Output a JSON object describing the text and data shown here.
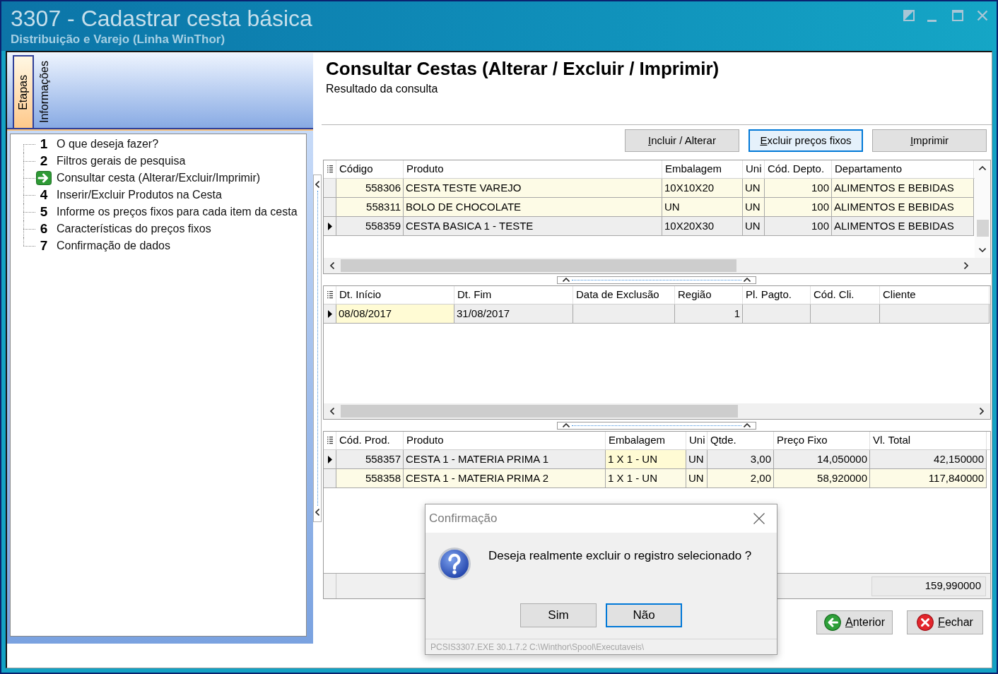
{
  "window": {
    "title": "3307 - Cadastrar cesta básica",
    "subtitle": "Distribuição e Varejo (Linha WinThor)"
  },
  "side_panel": {
    "tabs": [
      {
        "label": "Etapas",
        "selected": true
      },
      {
        "label": "Informações",
        "selected": false
      }
    ],
    "steps": [
      {
        "number": "1",
        "label": "O que deseja fazer?",
        "selected": false
      },
      {
        "number": "2",
        "label": "Filtros gerais de pesquisa",
        "selected": false
      },
      {
        "label": "Consultar cesta (Alterar/Excluir/Imprimir)",
        "selected": true
      },
      {
        "number": "4",
        "label": "Inserir/Excluir Produtos na Cesta",
        "selected": false
      },
      {
        "number": "5",
        "label": "Informe os preços fixos para cada item da cesta",
        "selected": false
      },
      {
        "number": "6",
        "label": "Características do preços fixos",
        "selected": false
      },
      {
        "number": "7",
        "label": "Confirmação de dados",
        "selected": false
      }
    ]
  },
  "page": {
    "title": "Consultar Cestas (Alterar / Excluir / Imprimir)",
    "subtitle": "Resultado da consulta"
  },
  "toolbar": [
    {
      "label": "Incluir / Alterar",
      "focused": false
    },
    {
      "label": "Excluir preços fixos",
      "focused": true
    },
    {
      "label": "Imprimir",
      "focused": false
    }
  ],
  "grids": [
    {
      "columns": [
        {
          "label": "Código",
          "kind": "number"
        },
        {
          "label": "Produto",
          "kind": "text"
        },
        {
          "label": "Embalagem",
          "kind": "text"
        },
        {
          "label": "Uni",
          "kind": "text"
        },
        {
          "label": "Cód. Depto.",
          "kind": "number"
        },
        {
          "label": "Departamento",
          "kind": "text"
        }
      ],
      "rows": [
        {
          "selected": false,
          "cells": [
            {
              "text": "558306",
              "focused": false
            },
            {
              "text": "CESTA TESTE VAREJO",
              "focused": false
            },
            {
              "text": "10X10X20",
              "focused": false
            },
            {
              "text": "UN",
              "focused": false
            },
            {
              "text": "100",
              "focused": false
            },
            {
              "text": "ALIMENTOS E BEBIDAS",
              "focused": false
            }
          ]
        },
        {
          "selected": false,
          "cells": [
            {
              "text": "558311",
              "focused": false
            },
            {
              "text": "BOLO DE CHOCOLATE",
              "focused": false
            },
            {
              "text": "UN",
              "focused": false
            },
            {
              "text": "UN",
              "focused": false
            },
            {
              "text": "100",
              "focused": false
            },
            {
              "text": "ALIMENTOS E BEBIDAS",
              "focused": false
            }
          ]
        },
        {
          "selected": true,
          "cells": [
            {
              "text": "558359",
              "focused": false
            },
            {
              "text": "CESTA BASICA 1 - TESTE",
              "focused": false
            },
            {
              "text": "10X20X30",
              "focused": false
            },
            {
              "text": "UN",
              "focused": false
            },
            {
              "text": "100",
              "focused": false
            },
            {
              "text": "ALIMENTOS E BEBIDAS",
              "focused": false
            }
          ]
        }
      ]
    },
    {
      "columns": [
        {
          "label": "Dt. Início",
          "kind": "text"
        },
        {
          "label": "Dt. Fim",
          "kind": "text"
        },
        {
          "label": "Data de Exclusão",
          "kind": "text"
        },
        {
          "label": "Região",
          "kind": "number"
        },
        {
          "label": "Pl. Pagto.",
          "kind": "text"
        },
        {
          "label": "Cód. Cli.",
          "kind": "text"
        },
        {
          "label": "Cliente",
          "kind": "text"
        }
      ],
      "rows": [
        {
          "selected": true,
          "cells": [
            {
              "text": "08/08/2017",
              "focused": true
            },
            {
              "text": "31/08/2017",
              "focused": false
            },
            {
              "focused": false
            },
            {
              "text": "1",
              "focused": false
            },
            {
              "focused": false
            },
            {
              "focused": false
            },
            {
              "focused": false
            }
          ]
        }
      ]
    },
    {
      "columns": [
        {
          "label": "Cód. Prod.",
          "kind": "number"
        },
        {
          "label": "Produto",
          "kind": "text"
        },
        {
          "label": "Embalagem",
          "kind": "text"
        },
        {
          "label": "Uni",
          "kind": "text"
        },
        {
          "label": "Qtde.",
          "kind": "number"
        },
        {
          "label": "Preço Fixo",
          "kind": "number"
        },
        {
          "label": "Vl. Total",
          "kind": "number"
        }
      ],
      "rows": [
        {
          "selected": true,
          "cells": [
            {
              "text": "558357",
              "focused": false
            },
            {
              "text": "CESTA 1 - MATERIA PRIMA 1",
              "focused": false
            },
            {
              "text": "1 X 1 - UN",
              "focused": true
            },
            {
              "text": "UN",
              "focused": false
            },
            {
              "text": "3,00",
              "focused": false
            },
            {
              "text": "14,050000",
              "focused": false
            },
            {
              "text": "42,150000",
              "focused": false
            }
          ]
        },
        {
          "selected": false,
          "cells": [
            {
              "text": "558358",
              "focused": false
            },
            {
              "text": "CESTA 1 - MATERIA PRIMA 2",
              "focused": false
            },
            {
              "text": "1 X 1 - UN",
              "focused": false
            },
            {
              "text": "UN",
              "focused": false
            },
            {
              "text": "2,00",
              "focused": false
            },
            {
              "text": "58,920000",
              "focused": false
            },
            {
              "text": "117,840000",
              "focused": false
            }
          ]
        }
      ],
      "footer": {
        "total": "159,990000"
      }
    }
  ],
  "nav_buttons": [
    {
      "kind": "back",
      "label": "Anterior"
    },
    {
      "kind": "close",
      "label": "Fechar"
    }
  ],
  "dialog": {
    "title": "Confirmação",
    "message": "Deseja realmente excluir o registro selecionado ?",
    "buttons": [
      {
        "label": "Sim",
        "default": false
      },
      {
        "label": "Não",
        "default": true
      }
    ],
    "status": "PCSIS3307.EXE 30.1.7.2 C:\\Winthor\\Spool\\Executaveis\\"
  }
}
